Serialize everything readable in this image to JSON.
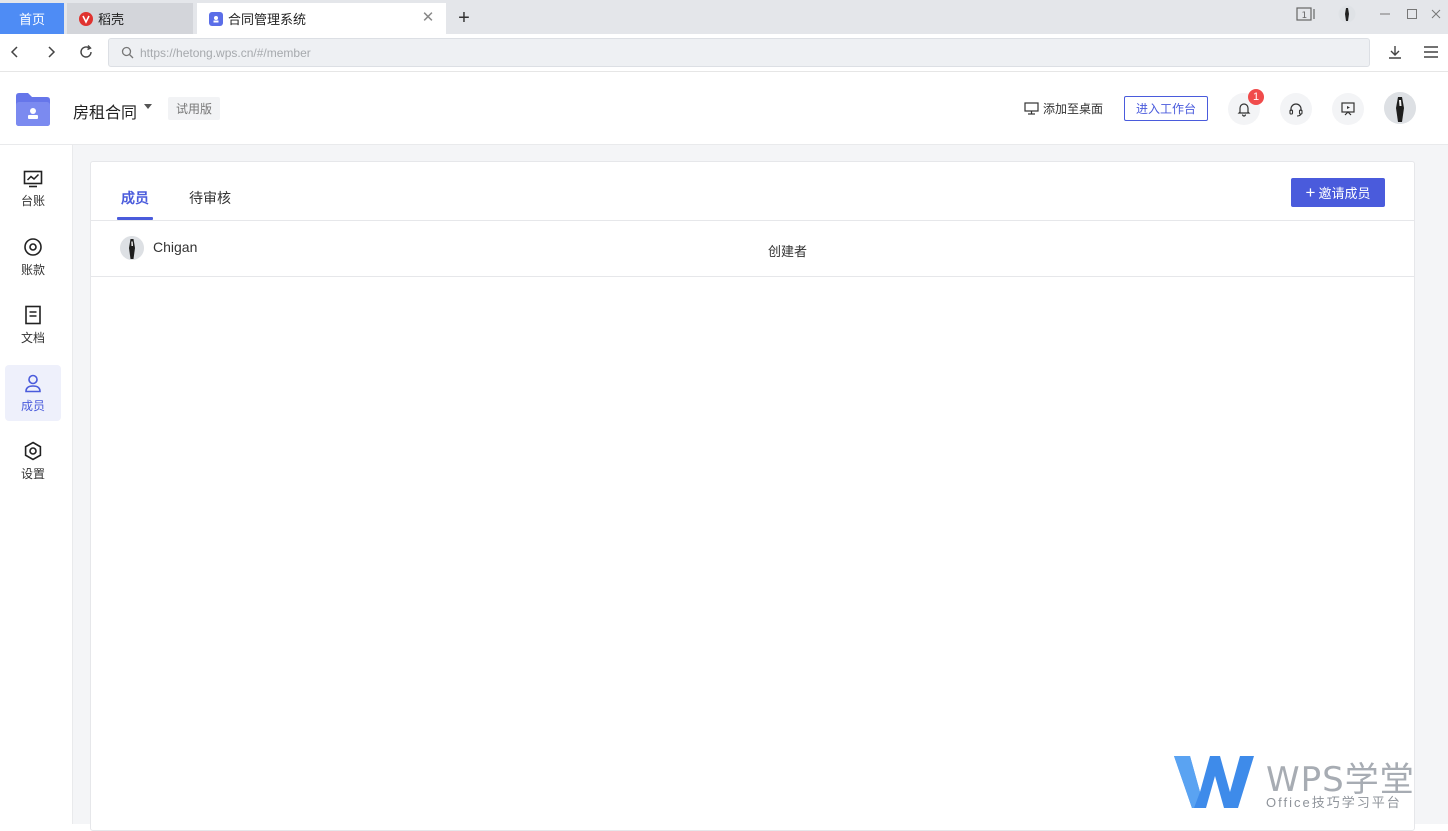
{
  "browser": {
    "home_tab": "首页",
    "tabs": [
      {
        "label": "稻壳"
      },
      {
        "label": "合同管理系统"
      }
    ],
    "url": "https://hetong.wps.cn/#/member"
  },
  "header": {
    "project_name": "房租合同",
    "trial_label": "试用版",
    "add_to_desktop": "添加至桌面",
    "enter_workspace": "进入工作台",
    "notification_count": "1"
  },
  "sidebar": {
    "items": [
      {
        "label": "台账",
        "icon": "chart-monitor-icon"
      },
      {
        "label": "账款",
        "icon": "coin-icon"
      },
      {
        "label": "文档",
        "icon": "document-icon"
      },
      {
        "label": "成员",
        "icon": "user-icon",
        "active": true
      },
      {
        "label": "设置",
        "icon": "gear-icon"
      }
    ]
  },
  "main": {
    "tabs": [
      {
        "label": "成员",
        "active": true
      },
      {
        "label": "待审核"
      }
    ],
    "invite_button": "邀请成员",
    "members": [
      {
        "name": "Chigan",
        "role": "创建者"
      }
    ]
  },
  "watermark": {
    "brand": "WPS学堂",
    "subtitle": "Office技巧学习平台"
  },
  "colors": {
    "accent": "#4a5bdc",
    "home_tab": "#4e8cf5",
    "badge": "#f04b4b"
  }
}
